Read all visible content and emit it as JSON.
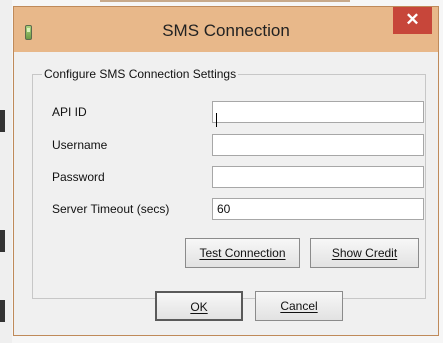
{
  "window": {
    "title": "SMS Connection",
    "close_glyph": "✕",
    "icon": "battery-icon"
  },
  "group": {
    "legend": "Configure SMS Connection Settings"
  },
  "fields": {
    "api_id": {
      "label": "API ID",
      "value": ""
    },
    "username": {
      "label": "Username",
      "value": ""
    },
    "password": {
      "label": "Password",
      "value": ""
    },
    "server_timeout": {
      "label": "Server Timeout (secs)",
      "value": "60"
    }
  },
  "buttons": {
    "test_connection": "Test Connection",
    "show_credit": "Show Credit",
    "ok": "OK",
    "cancel": "Cancel"
  },
  "colors": {
    "titlebar": "#e8b88a",
    "close_button": "#c7463a",
    "window_border": "#bf8a5a"
  }
}
